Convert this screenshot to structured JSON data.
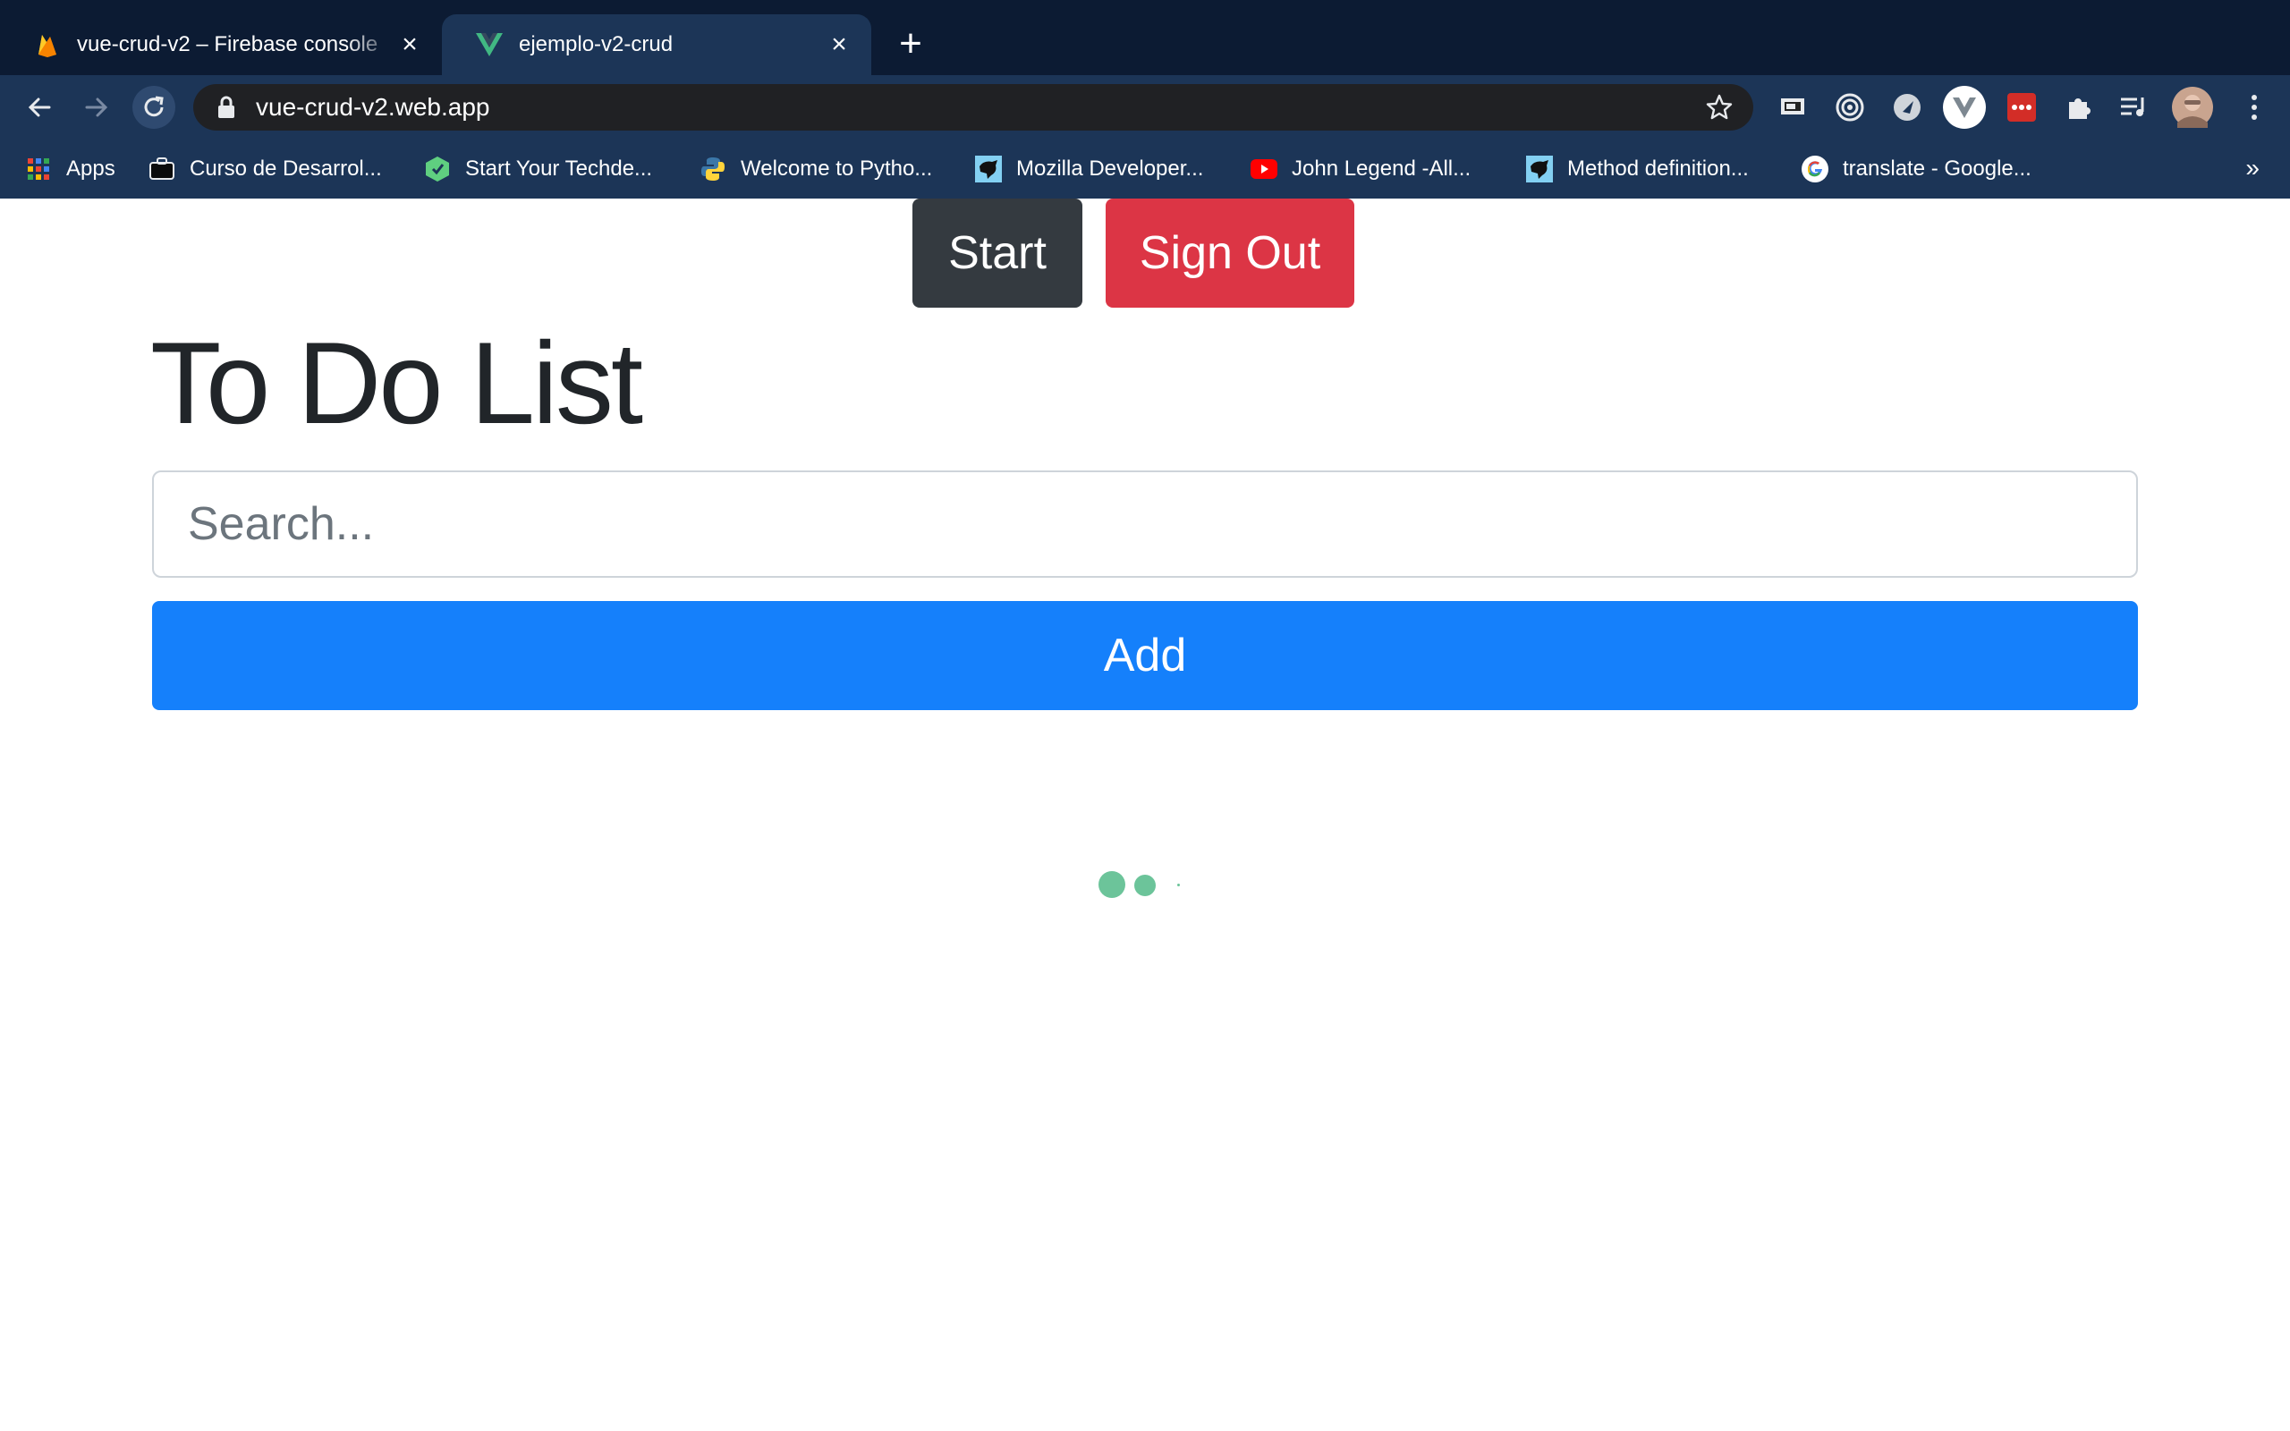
{
  "browser": {
    "tabs": [
      {
        "title": "vue-crud-v2 – Firebase console",
        "favicon": "firebase-icon",
        "active": false
      },
      {
        "title": "ejemplo-v2-crud",
        "favicon": "vue-icon",
        "active": true
      }
    ],
    "url": "vue-crud-v2.web.app",
    "bookmarks": [
      {
        "label": "Apps",
        "icon": "apps-grid-icon"
      },
      {
        "label": "Curso de Desarrol...",
        "icon": "bookmark-icon"
      },
      {
        "label": "Start Your Techde...",
        "icon": "techdegree-icon"
      },
      {
        "label": "Welcome to Pytho...",
        "icon": "python-icon"
      },
      {
        "label": "Mozilla Developer...",
        "icon": "mdn-icon"
      },
      {
        "label": "John Legend -All...",
        "icon": "youtube-icon"
      },
      {
        "label": "Method definition...",
        "icon": "mdn-icon"
      },
      {
        "label": "translate - Google...",
        "icon": "google-icon"
      }
    ],
    "more_bookmarks": "»"
  },
  "page": {
    "start_label": "Start",
    "signout_label": "Sign Out",
    "title": "To Do List",
    "search_placeholder": "Search...",
    "add_label": "Add"
  },
  "colors": {
    "tabstrip": "#0c1b33",
    "toolbar": "#1c3557",
    "start_button": "#343a40",
    "signout_button": "#dc3545",
    "add_button": "#1580fb",
    "loader": "#6cc49a"
  }
}
